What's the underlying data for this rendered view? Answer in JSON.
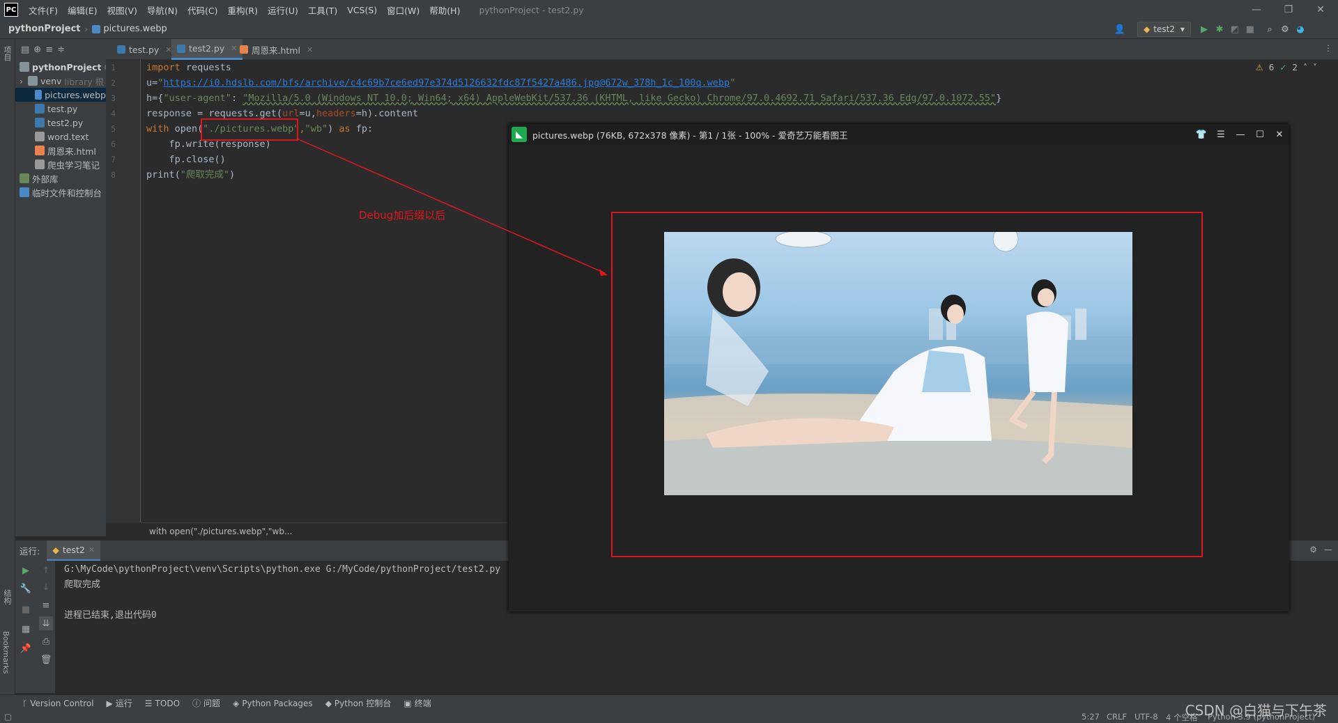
{
  "app": {
    "logo": "PC",
    "window_title": "pythonProject - test2.py"
  },
  "menu": [
    "文件(F)",
    "编辑(E)",
    "视图(V)",
    "导航(N)",
    "代码(C)",
    "重构(R)",
    "运行(U)",
    "工具(T)",
    "VCS(S)",
    "窗口(W)",
    "帮助(H)"
  ],
  "nav": {
    "project": "pythonProject",
    "file": "pictures.webp",
    "run_config": "test2"
  },
  "tabs": [
    {
      "label": "test.py"
    },
    {
      "label": "test2.py"
    },
    {
      "label": "周恩来.html"
    }
  ],
  "project_tree": {
    "root": "pythonProject",
    "root_suffix": "G",
    "items": [
      {
        "label": "venv",
        "hint": "library 根"
      },
      {
        "label": "pictures.webp"
      },
      {
        "label": "test.py"
      },
      {
        "label": "test2.py"
      },
      {
        "label": "word.text"
      },
      {
        "label": "周恩来.html"
      },
      {
        "label": "爬虫学习笔记"
      },
      {
        "label": "外部库"
      },
      {
        "label": "临时文件和控制台"
      }
    ]
  },
  "left_strip_label": "项目",
  "code": {
    "line_numbers": [
      "1",
      "2",
      "3",
      "4",
      "5",
      "6",
      "7",
      "8"
    ],
    "l1_kw": "import",
    "l1_rest": " requests",
    "l2_a": "u=",
    "l2_q1": "\"",
    "l2_url": "https://i0.hdslb.com/bfs/archive/c4c69b7ce6ed97e374d5126632fdc87f5427a486.jpg@672w_378h_1c_100q.webp",
    "l2_q2": "\"",
    "l3_a": "h={",
    "l3_key": "\"user-agent\"",
    "l3_colon": ": ",
    "l3_val": "\"Mozilla/5.0 (Windows NT 10.0; Win64; x64) AppleWebKit/537.36 (KHTML, like Gecko) Chrome/97.0.4692.71 Safari/537.36 Edg/97.0.1072.55\"",
    "l3_end": "}",
    "l4_a": "response = requests.get(",
    "l4_p1": "url",
    "l4_b": "=u,",
    "l4_p2": "headers",
    "l4_c": "=h).content",
    "l5_kw": "with",
    "l5_open": " open(",
    "l5_path": "\"./pictures.webp\"",
    "l5_comma": ",",
    "l5_mode": "\"wb\"",
    "l5_close": ") ",
    "l5_as": "as",
    "l5_end": " fp:",
    "l6": "    fp.write(response)",
    "l7": "    fp.close()",
    "l8_a": "print(",
    "l8_str": "\"爬取完成\"",
    "l8_b": ")"
  },
  "editor_status": {
    "warnings": "6",
    "ok": "2"
  },
  "breadcrumb": "with open(\"./pictures.webp\",\"wb...",
  "annotation": "Debug加后缀以后",
  "run_panel": {
    "label": "运行:",
    "tab": "test2",
    "lines": [
      "G:\\MyCode\\pythonProject\\venv\\Scripts\\python.exe G:/MyCode/pythonProject/test2.py",
      "爬取完成",
      "",
      "进程已结束,退出代码0"
    ]
  },
  "bottom_tabs": [
    "Version Control",
    "运行",
    "TODO",
    "问题",
    "Python Packages",
    "Python 控制台",
    "终端"
  ],
  "left_bottom_labels": [
    "结构",
    "Bookmarks"
  ],
  "status": {
    "position": "5:27",
    "line_sep": "CRLF",
    "encoding": "UTF-8",
    "indent": "4 个空格",
    "interpreter": "Python 3.9 (pythonProject)"
  },
  "viewer": {
    "title": "pictures.webp (76KB, 672x378 像素) - 第1 / 1张 - 100% - 爱奇艺万能看图王"
  },
  "watermark": "CSDN @白猫与下午茶",
  "colors": {
    "keyword": "#cc7832",
    "string": "#6a8759",
    "link": "#287bde",
    "param": "#aa4926",
    "annotation_red": "#e0161f",
    "selection": "#0d293e",
    "accent": "#4a88c7"
  }
}
